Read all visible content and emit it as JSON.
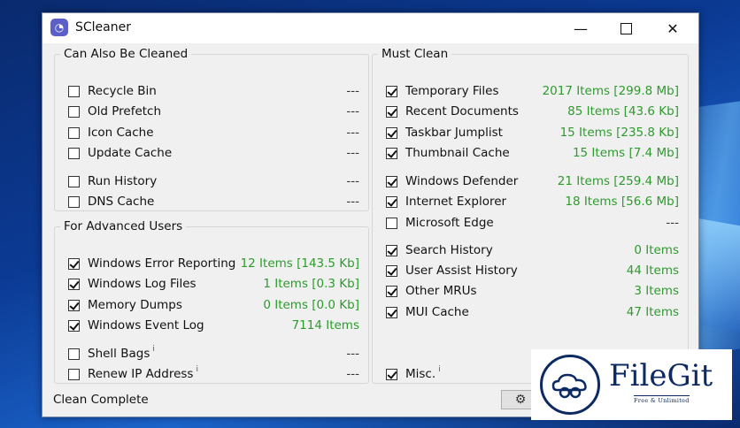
{
  "window": {
    "title": "SCleaner",
    "minimize_glyph": "—",
    "close_glyph": "✕"
  },
  "groups": {
    "also_cleaned": {
      "title": "Can Also Be Cleaned",
      "items": [
        {
          "label": "Recycle Bin",
          "value": "---",
          "checked": false
        },
        {
          "label": "Old Prefetch",
          "value": "---",
          "checked": false
        },
        {
          "label": "Icon Cache",
          "value": "---",
          "checked": false
        },
        {
          "label": "Update Cache",
          "value": "---",
          "checked": false
        },
        {
          "label": "Run History",
          "value": "---",
          "checked": false
        },
        {
          "label": "DNS Cache",
          "value": "---",
          "checked": false
        }
      ]
    },
    "advanced": {
      "title": "For Advanced Users",
      "items": [
        {
          "label": "Windows Error Reporting",
          "value": "12 Items [143.5 Kb]",
          "checked": true
        },
        {
          "label": "Windows Log Files",
          "value": "1 Items [0.3 Kb]",
          "checked": true
        },
        {
          "label": "Memory Dumps",
          "value": "0 Items [0.0 Kb]",
          "checked": true
        },
        {
          "label": "Windows Event Log",
          "value": "7114 Items",
          "checked": true
        },
        {
          "label": "Shell Bags",
          "value": "---",
          "checked": false,
          "info": "i"
        },
        {
          "label": "Renew IP Address",
          "value": "---",
          "checked": false,
          "info": "i"
        }
      ]
    },
    "must_clean": {
      "title": "Must Clean",
      "items": [
        {
          "label": "Temporary Files",
          "value": "2017 Items [299.8 Mb]",
          "checked": true
        },
        {
          "label": "Recent Documents",
          "value": "85 Items [43.6 Kb]",
          "checked": true
        },
        {
          "label": "Taskbar Jumplist",
          "value": "15 Items [235.8 Kb]",
          "checked": true
        },
        {
          "label": "Thumbnail Cache",
          "value": "15 Items [7.4 Mb]",
          "checked": true
        },
        {
          "label": "Windows Defender",
          "value": "21 Items [259.4 Mb]",
          "checked": true
        },
        {
          "label": "Internet Explorer",
          "value": "18 Items [56.6 Mb]",
          "checked": true
        },
        {
          "label": "Microsoft Edge",
          "value": "---",
          "checked": false
        },
        {
          "label": "Search History",
          "value": "0 Items",
          "checked": true
        },
        {
          "label": "User Assist History",
          "value": "44 Items",
          "checked": true
        },
        {
          "label": "Other MRUs",
          "value": "3 Items",
          "checked": true
        },
        {
          "label": "MUI Cache",
          "value": "47 Items",
          "checked": true
        },
        {
          "label": "Misc.",
          "value": "",
          "checked": true,
          "info": "i"
        }
      ]
    }
  },
  "status": "Clean Complete",
  "colors": {
    "value_green": "#2e9a2e",
    "accent_icon": "#5b5fc7"
  },
  "icons": {
    "settings": "gear-icon",
    "app": "app-logo-icon"
  },
  "watermark": {
    "brand": "FileGit",
    "tagline": "Free & Unlimited"
  }
}
